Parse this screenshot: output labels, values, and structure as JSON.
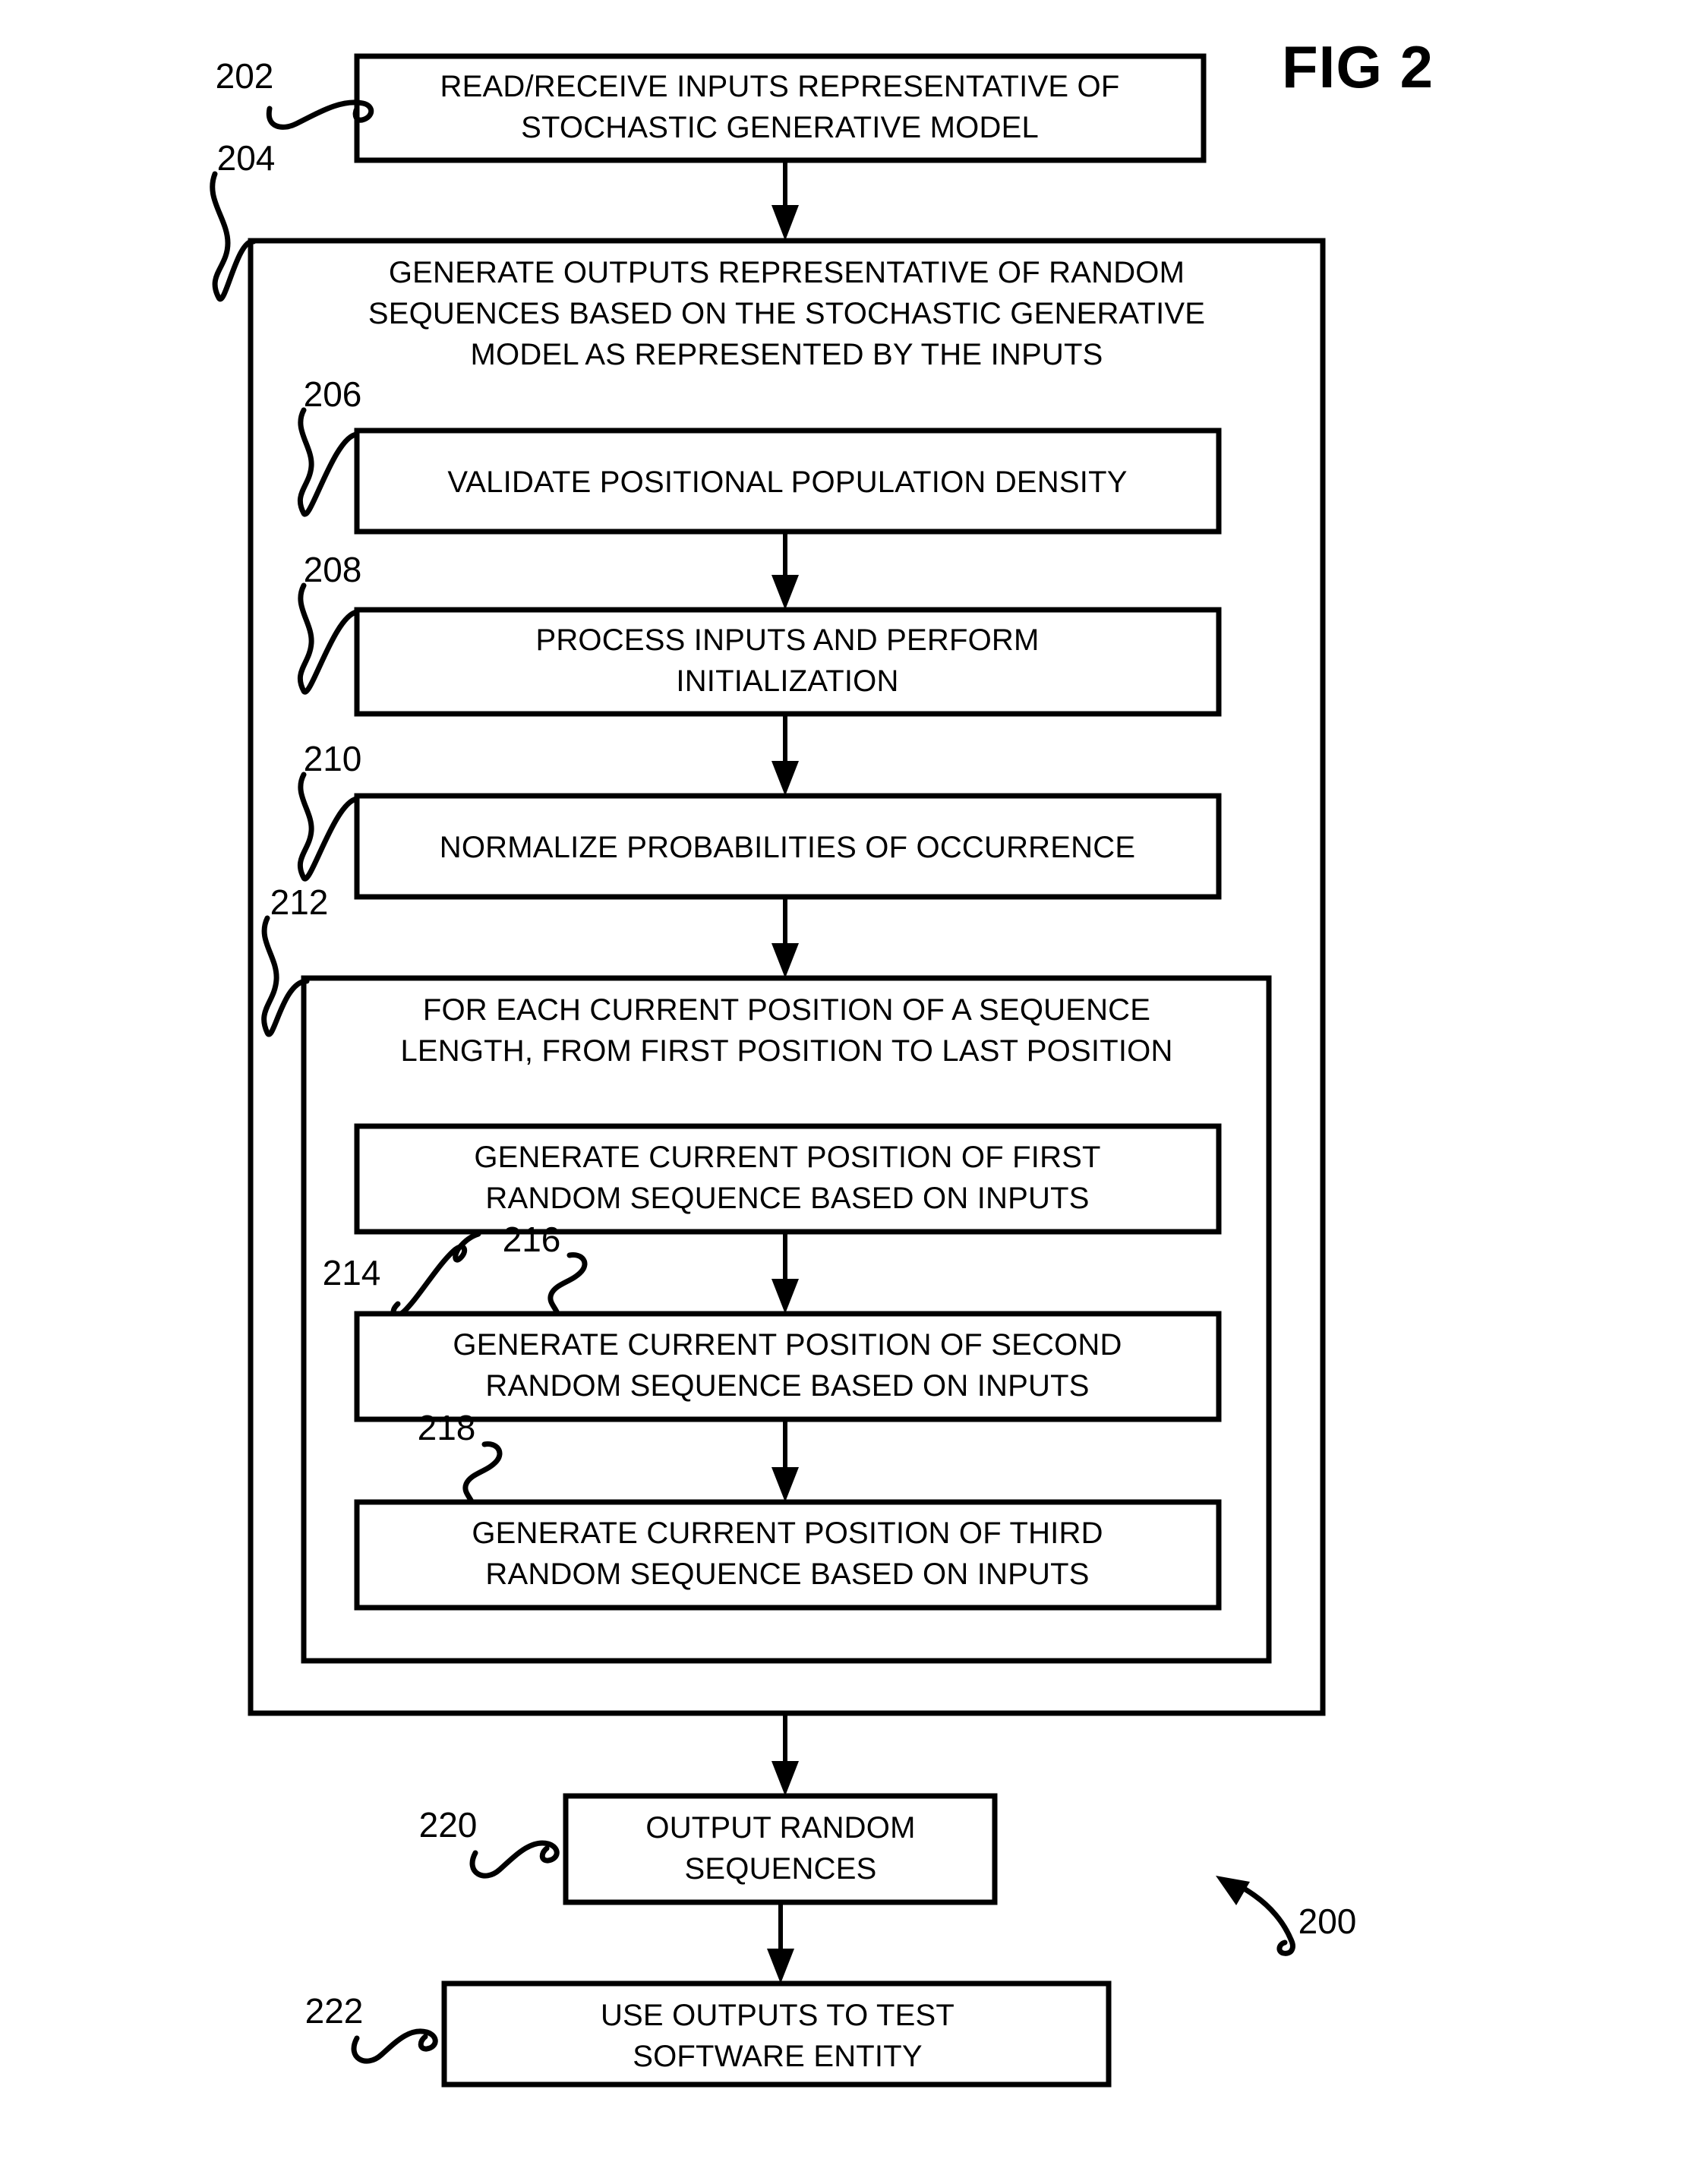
{
  "figure": {
    "title": "FIG 2",
    "overall_reference": "200"
  },
  "boxes": {
    "read_inputs": {
      "ref": "202",
      "line1": "READ/RECEIVE INPUTS REPRESENTATIVE OF",
      "line2": "STOCHASTIC GENERATIVE MODEL"
    },
    "generate_outputs": {
      "ref": "204",
      "line1": "GENERATE OUTPUTS REPRESENTATIVE OF RANDOM",
      "line2": "SEQUENCES BASED ON THE STOCHASTIC GENERATIVE",
      "line3": "MODEL AS REPRESENTED BY THE INPUTS"
    },
    "validate_density": {
      "ref": "206",
      "line1": "VALIDATE POSITIONAL POPULATION DENSITY"
    },
    "process_inputs": {
      "ref": "208",
      "line1": "PROCESS INPUTS AND PERFORM",
      "line2": "INITIALIZATION"
    },
    "normalize_probabilities": {
      "ref": "210",
      "line1": "NORMALIZE PROBABILITIES OF OCCURRENCE"
    },
    "for_each_position": {
      "ref": "212",
      "line1": "FOR EACH CURRENT POSITION OF A SEQUENCE",
      "line2": "LENGTH, FROM FIRST POSITION TO LAST POSITION"
    },
    "generate_first": {
      "ref": "214",
      "line1": "GENERATE CURRENT POSITION OF FIRST",
      "line2": "RANDOM SEQUENCE BASED ON INPUTS"
    },
    "generate_second": {
      "ref": "216",
      "line1": "GENERATE CURRENT POSITION OF SECOND",
      "line2": "RANDOM SEQUENCE BASED ON INPUTS"
    },
    "generate_third": {
      "ref": "218",
      "line1": "GENERATE CURRENT POSITION OF THIRD",
      "line2": "RANDOM SEQUENCE BASED ON INPUTS"
    },
    "output_sequences": {
      "ref": "220",
      "line1": "OUTPUT RANDOM",
      "line2": "SEQUENCES"
    },
    "use_outputs": {
      "ref": "222",
      "line1": "USE OUTPUTS TO TEST",
      "line2": "SOFTWARE ENTITY"
    }
  },
  "colors": {
    "ink": "#000000",
    "paper": "#ffffff"
  }
}
